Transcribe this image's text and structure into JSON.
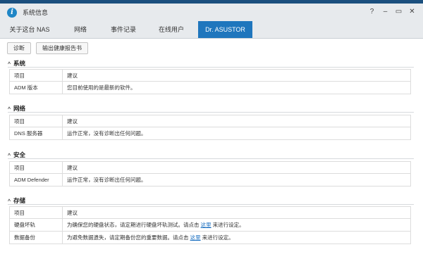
{
  "window": {
    "title": "系统信息",
    "controls": [
      "?",
      "–",
      "▭",
      "✕"
    ]
  },
  "tabs": [
    {
      "label": "关于这台 NAS"
    },
    {
      "label": "网络"
    },
    {
      "label": "事件记录"
    },
    {
      "label": "在线用户"
    },
    {
      "label": "Dr. ASUSTOR",
      "active": true
    }
  ],
  "toolbar": {
    "diagnose": "诊断",
    "export": "输出健康报告书"
  },
  "sections": [
    {
      "title": "系统",
      "header": [
        "项目",
        "建议"
      ],
      "rows": [
        {
          "item": "ADM 版本",
          "advice": "您目前使用的是最新的软件。"
        }
      ]
    },
    {
      "title": "网络",
      "header": [
        "项目",
        "建议"
      ],
      "rows": [
        {
          "item": "DNS 服务器",
          "advice": "运作正常，没有诊断出任何问题。"
        }
      ]
    },
    {
      "title": "安全",
      "header": [
        "项目",
        "建议"
      ],
      "rows": [
        {
          "item": "ADM Defender",
          "advice": "运作正常，没有诊断出任何问题。"
        }
      ]
    },
    {
      "title": "存储",
      "header": [
        "项目",
        "建议"
      ],
      "rows": [
        {
          "item": "硬盘坏轨",
          "advice_pre": "为确保您的硬盘状态，请定期进行硬盘坏轨测试。请点击 ",
          "link": "这里",
          "advice_post": " 来进行设定。"
        },
        {
          "item": "数据备份",
          "advice_pre": "为避免数据遗失，请定期备份您的重要数据。请点击 ",
          "link": "这里",
          "advice_post": " 来进行设定。"
        }
      ]
    }
  ]
}
